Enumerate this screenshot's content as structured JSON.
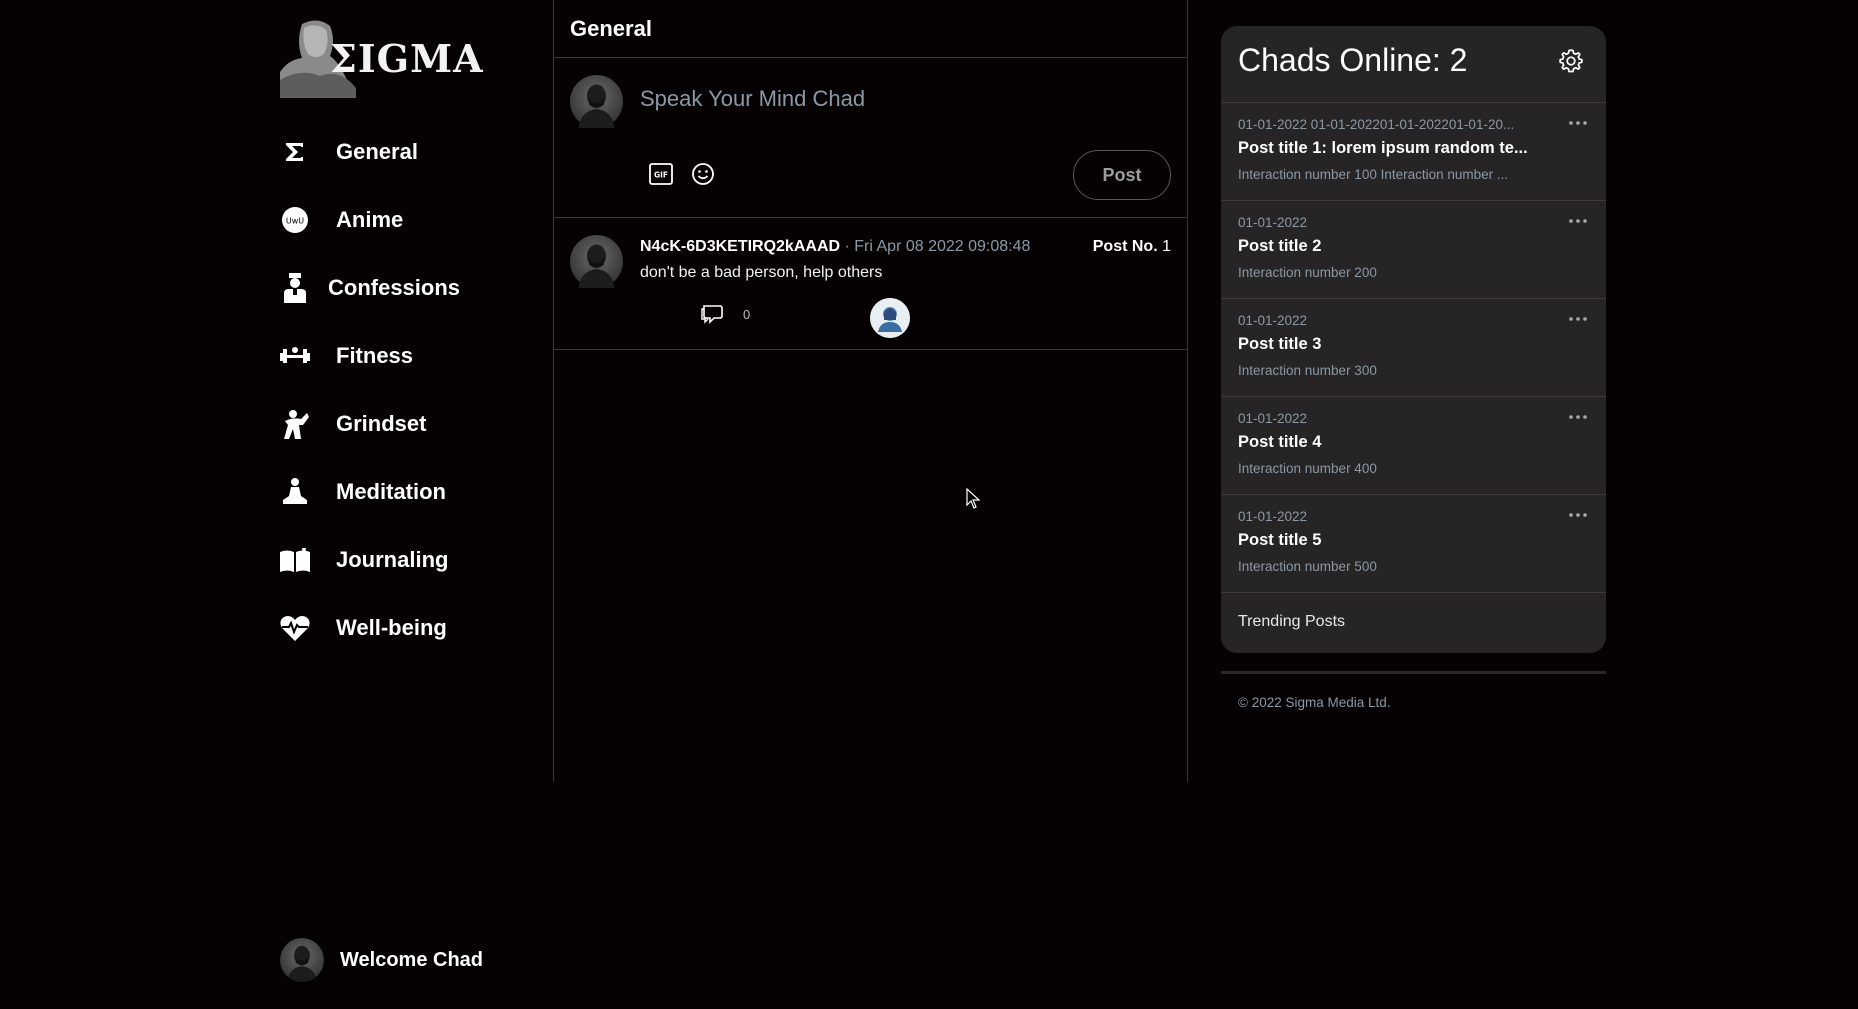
{
  "brand": {
    "name": "ΣIGMA"
  },
  "nav": {
    "items": [
      {
        "label": "General",
        "icon": "sigma-icon"
      },
      {
        "label": "Anime",
        "icon": "uwu-icon"
      },
      {
        "label": "Confessions",
        "icon": "priest-icon"
      },
      {
        "label": "Fitness",
        "icon": "dumbbell-icon"
      },
      {
        "label": "Grindset",
        "icon": "flexing-arm-icon"
      },
      {
        "label": "Meditation",
        "icon": "meditation-icon"
      },
      {
        "label": "Journaling",
        "icon": "open-book-icon"
      },
      {
        "label": "Well-being",
        "icon": "heart-pulse-icon"
      }
    ]
  },
  "user": {
    "welcome": "Welcome Chad"
  },
  "feed": {
    "title": "General",
    "composer": {
      "placeholder": "Speak Your Mind Chad",
      "gif_label": "GIF",
      "post_label": "Post"
    },
    "posts": [
      {
        "user": "N4cK-6D3KETIRQ2kAAAD",
        "separator": "·",
        "date": "Fri Apr 08 2022 09:08:48",
        "post_no_label": "Post No.",
        "post_no": "1",
        "body": "don't be a bad person, help others",
        "replies": "0"
      }
    ]
  },
  "panel": {
    "title": "Chads Online: 2",
    "trends": [
      {
        "date": "01-01-2022 01-01-202201-01-202201-01-20...",
        "title": "Post title 1: lorem ipsum random te...",
        "sub": "Interaction number 100 Interaction number ..."
      },
      {
        "date": "01-01-2022",
        "title": "Post title 2",
        "sub": "Interaction number 200"
      },
      {
        "date": "01-01-2022",
        "title": "Post title 3",
        "sub": "Interaction number 300"
      },
      {
        "date": "01-01-2022",
        "title": "Post title 4",
        "sub": "Interaction number 400"
      },
      {
        "date": "01-01-2022",
        "title": "Post title 5",
        "sub": "Interaction number 500"
      }
    ],
    "footer": "Trending Posts"
  },
  "copyright": "© 2022 Sigma Media Ltd.",
  "colors": {
    "background": "#060203",
    "panel": "#272425",
    "muted": "#8b98a5",
    "border": "#3a3536"
  }
}
